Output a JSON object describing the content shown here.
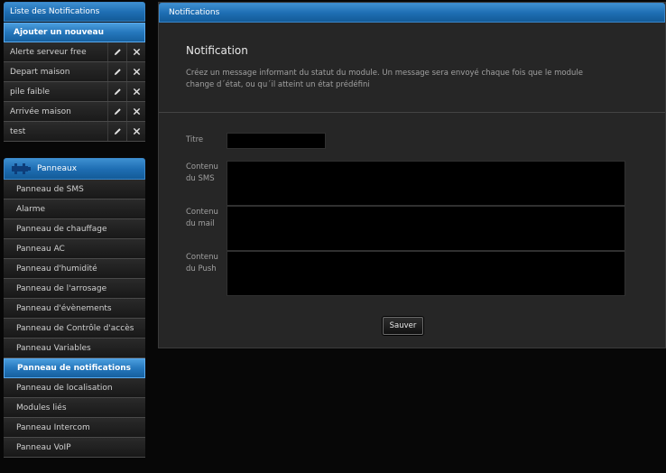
{
  "notifications_list": {
    "title": "Liste des Notifications",
    "add_label": "Ajouter un nouveau",
    "items": [
      {
        "label": "Alerte serveur free"
      },
      {
        "label": "Depart maison"
      },
      {
        "label": "pile faible"
      },
      {
        "label": "Arrivée maison"
      },
      {
        "label": "test"
      }
    ]
  },
  "panels": {
    "title": "Panneaux",
    "icon": "puzzle-icon",
    "items": [
      {
        "label": "Panneau de SMS"
      },
      {
        "label": "Alarme"
      },
      {
        "label": "Panneau de chauffage"
      },
      {
        "label": "Panneau AC"
      },
      {
        "label": "Panneau d'humidité"
      },
      {
        "label": "Panneau de l'arrosage"
      },
      {
        "label": "Panneau d'évènements"
      },
      {
        "label": "Panneau de Contrôle d'accès"
      },
      {
        "label": "Panneau Variables"
      },
      {
        "label": "Panneau de notifications",
        "active": true
      },
      {
        "label": "Panneau de localisation"
      },
      {
        "label": "Modules liés"
      },
      {
        "label": "Panneau Intercom"
      },
      {
        "label": "Panneau VoIP"
      }
    ]
  },
  "main": {
    "header": "Notifications",
    "title": "Notification",
    "description": "Créez un message informant du statut du module. Un message sera envoyé chaque fois que le module change d´état, ou qu´il atteint un état prédéfini",
    "fields": {
      "titre_label": "Titre",
      "titre_value": "",
      "sms_label": "Contenu du SMS",
      "sms_value": "",
      "mail_label": "Contenu du mail",
      "mail_value": "",
      "push_label": "Contenu du Push",
      "push_value": ""
    },
    "save_label": "Sauver"
  },
  "colors": {
    "accent": "#1f6fb4",
    "background": "#070707",
    "panel": "#262626"
  }
}
